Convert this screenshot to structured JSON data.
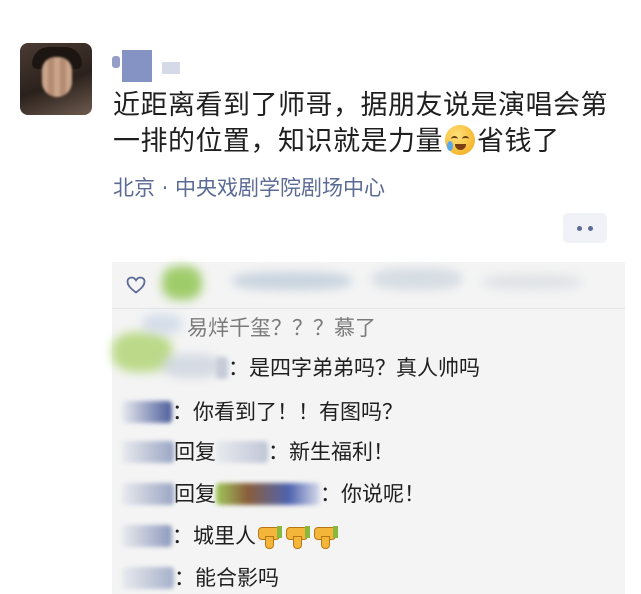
{
  "post": {
    "text_part1": "近距离看到了师哥，据朋友说是演唱会第一排的位置，知识就是力量",
    "emoji": "crying-laughing-emoji",
    "text_part2": "省钱了",
    "location": "北京 · 中央戏剧学院剧场中心"
  },
  "comments": [
    {
      "visible_text": "易烊千玺？？？慕了"
    },
    {
      "text": "：是四字弟弟吗？真人帅吗"
    },
    {
      "text": "：你看到了！！有图吗？"
    },
    {
      "reply_word": "回复",
      "text": "：新生福利！"
    },
    {
      "reply_word": "回复",
      "text": "：你说呢！"
    },
    {
      "text": "：城里人",
      "icons": [
        "thumbs-down-icon",
        "thumbs-down-icon",
        "thumbs-down-icon"
      ]
    },
    {
      "text": "：能合影吗"
    }
  ],
  "colors": {
    "link": "#5b6b95",
    "panel_bg": "#f4f4f4",
    "more_button_bg": "#f0f2f7"
  },
  "icons": {
    "like": "heart-outline-icon",
    "more": "more-dots-icon"
  }
}
